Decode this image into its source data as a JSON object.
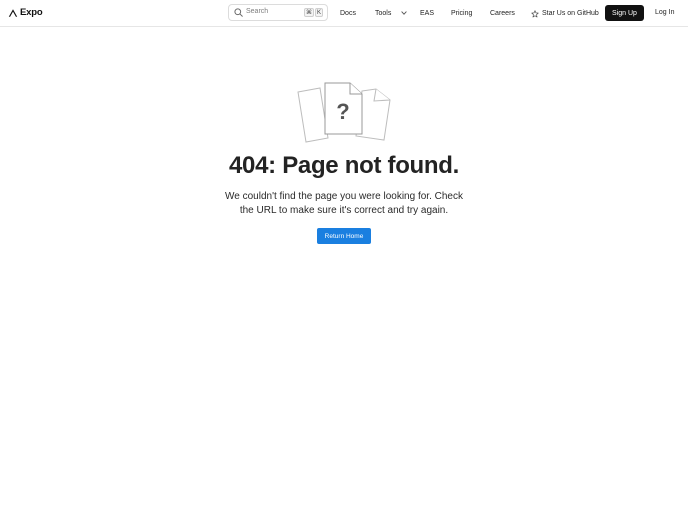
{
  "header": {
    "logo_text": "Expo",
    "search": {
      "placeholder": "Search",
      "shortcut_cmd": "⌘",
      "shortcut_key": "K"
    },
    "nav": {
      "docs": "Docs",
      "tools": "Tools",
      "eas": "EAS",
      "pricing": "Pricing",
      "careers": "Careers",
      "github": "Star Us on GitHub"
    },
    "signup": "Sign Up",
    "login": "Log In"
  },
  "main": {
    "title": "404: Page not found.",
    "message": "We couldn't find the page you were looking for. Check the URL to make sure it's correct and try again.",
    "return_button": "Return Home"
  },
  "colors": {
    "accent": "#1a7fe0",
    "signup_bg": "#111111",
    "text": "#232323"
  }
}
